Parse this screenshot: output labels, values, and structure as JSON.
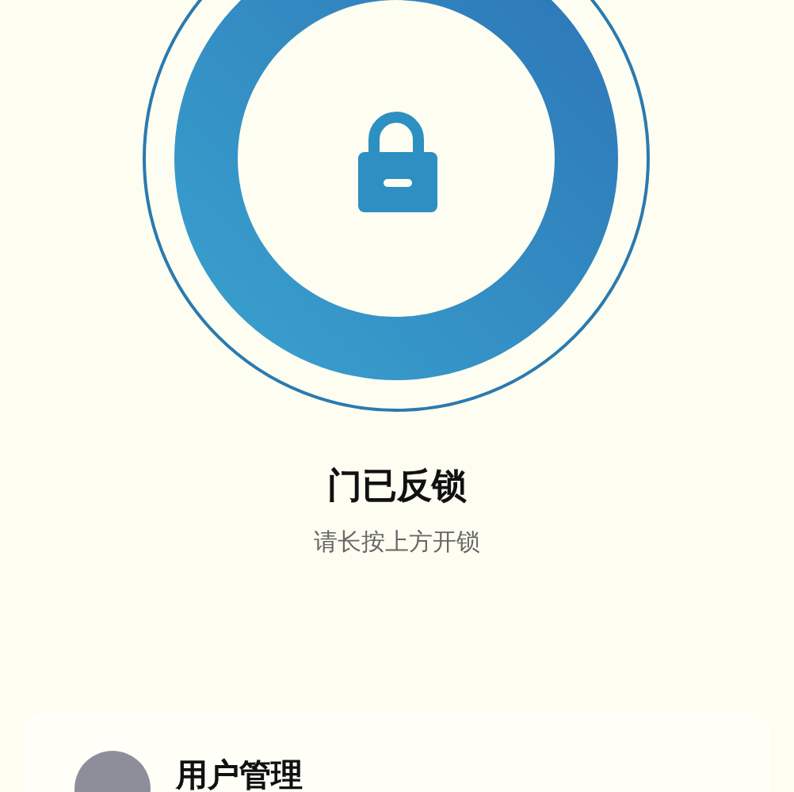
{
  "status": {
    "title": "门已反锁",
    "hint": "请长按上方开锁"
  },
  "menu": [
    {
      "label": "用户管理"
    }
  ]
}
